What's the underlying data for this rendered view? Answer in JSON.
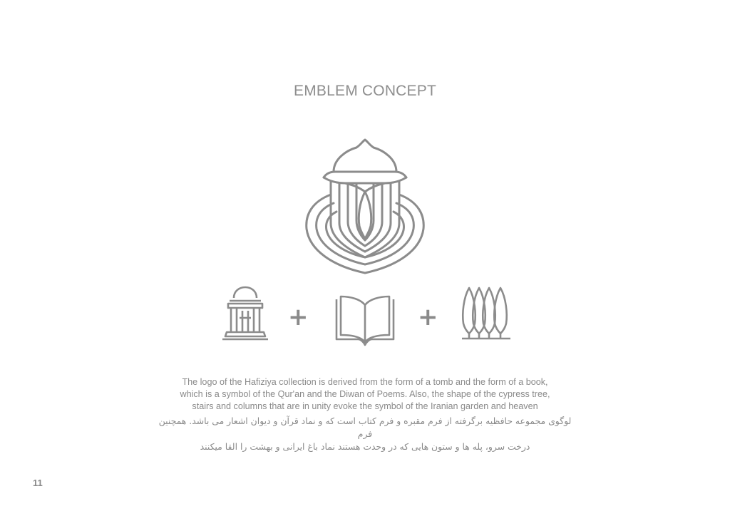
{
  "title": "EMBLEM CONCEPT",
  "icons": [
    "emblem-logo-icon",
    "tomb-pavilion-icon",
    "plus-icon",
    "open-book-icon",
    "plus-icon",
    "cypress-trees-icon"
  ],
  "plus_symbol": "+",
  "description_en": [
    "The logo of the Hafiziya collection is derived from the form of a tomb and the form of a book,",
    "which is a symbol of the Qur'an and the Diwan of Poems. Also, the shape of the cypress tree,",
    "stairs and columns that are in unity evoke the symbol of the Iranian garden and heaven"
  ],
  "description_fa": [
    "لوگوی مجموعه حافظیه برگرفته از فرم مقبره و فرم کتاب است که و نماد قرآن و دیوان اشعار می باشد. همچنین فرم",
    "درخت سرو، پله ها و ستون هایی که در وحدت هستند نماد باغ ایرانی و بهشت را القا میکنند"
  ],
  "page_number": "11",
  "colors": {
    "line": "#8c8c8c",
    "text": "#8a8a8a",
    "background": "#ffffff"
  }
}
